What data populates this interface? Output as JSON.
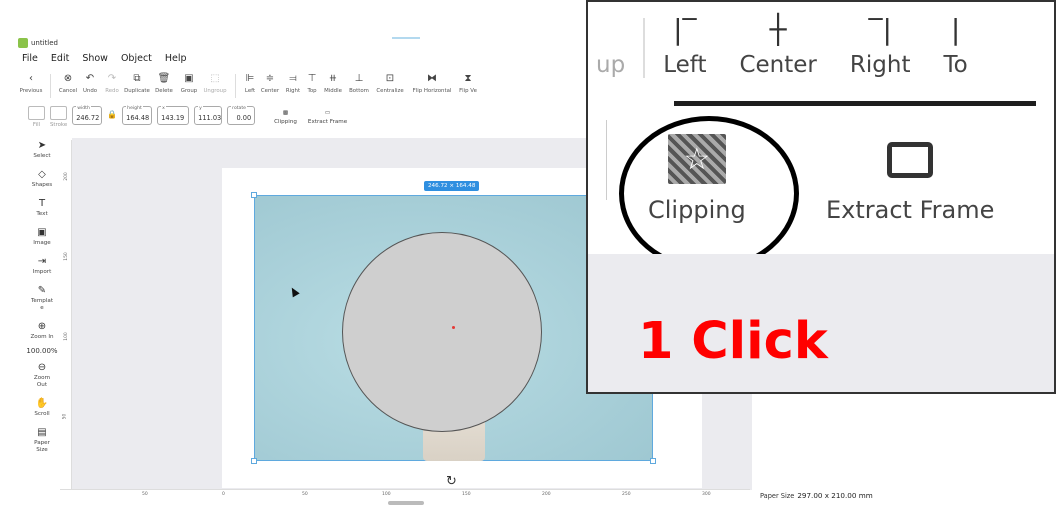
{
  "window": {
    "title": "untitled"
  },
  "menu": [
    "File",
    "Edit",
    "Show",
    "Object",
    "Help"
  ],
  "toolbar": {
    "previous": "Previous",
    "cancel": "Cancel",
    "undo": "Undo",
    "redo": "Redo",
    "duplicate": "Duplicate",
    "delete": "Delete",
    "group": "Group",
    "ungroup": "Ungroup",
    "left": "Left",
    "center": "Center",
    "right": "Right",
    "top": "Top",
    "middle": "Middle",
    "bottom": "Bottom",
    "centralize": "Centralize",
    "flip_horizontal": "Flip Horizontal",
    "flip_vertical": "Flip Ve"
  },
  "properties": {
    "fill": "Fill",
    "stroke": "Stroke",
    "width_label": "width",
    "width": "246.72",
    "height_label": "height",
    "height": "164.48",
    "x_label": "x",
    "x": "143.19",
    "y_label": "y",
    "y": "111.03",
    "rotate_label": "rotate",
    "rotate": "0.00",
    "clipping": "Clipping",
    "extract_frame": "Extract Frame"
  },
  "left_panel": {
    "select": "Select",
    "shapes": "Shapes",
    "text": "Text",
    "image": "Image",
    "import": "Import",
    "template": "Templat\ne",
    "zoom_in": "Zoom In",
    "zoom_value": "100.00%",
    "zoom_out": "Zoom\nOut",
    "scroll": "Scroll",
    "paper_size": "Paper\nSize"
  },
  "ruler": {
    "vertical": [
      "200",
      "150",
      "100",
      "50"
    ],
    "horizontal": [
      "50",
      "0",
      "50",
      "100",
      "150",
      "200",
      "250",
      "300"
    ]
  },
  "canvas": {
    "selection_size": "246.72 × 164.48"
  },
  "status": {
    "paper_size_label": "Paper Size",
    "paper_size_value": "297.00 x 210.00 mm"
  },
  "callout": {
    "tools": [
      "up",
      "Left",
      "Center",
      "Right",
      "To"
    ],
    "clipping": "Clipping",
    "extract_frame": "Extract Frame",
    "note": "1 Click"
  },
  "colors": {
    "accent": "#2f8fe0",
    "note": "#ff0000",
    "selection": "#5fa9de"
  }
}
